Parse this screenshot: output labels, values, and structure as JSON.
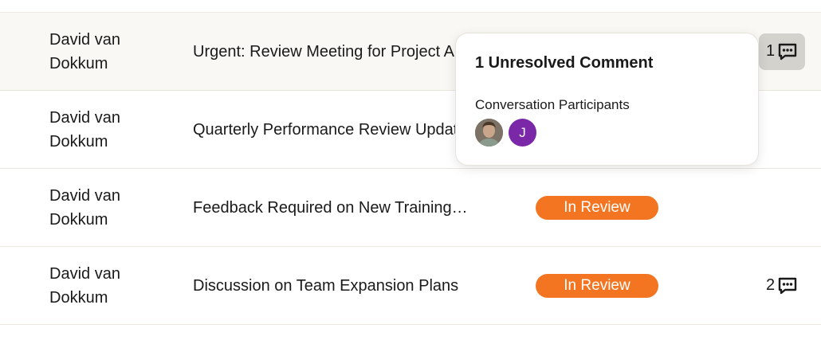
{
  "colors": {
    "status_in_review": "#f47521",
    "avatar_initial_bg": "#7a27a8",
    "row_highlight": "#f9f8f4",
    "comments_btn_active": "#d4d2cd"
  },
  "rows": [
    {
      "author": "David van Dokkum",
      "subject": "Urgent: Review Meeting for Project Alpha",
      "status": "",
      "comments_count": "1",
      "comments_icon": "comment-dots-icon"
    },
    {
      "author": "David van Dokkum",
      "subject": "Quarterly Performance Review Updates",
      "status": "",
      "comments_count": "",
      "comments_icon": ""
    },
    {
      "author": "David van Dokkum",
      "subject": "Feedback Required on New Training…",
      "status": "In Review",
      "comments_count": "",
      "comments_icon": ""
    },
    {
      "author": "David van Dokkum",
      "subject": "Discussion on Team Expansion Plans",
      "status": "In Review",
      "comments_count": "2",
      "comments_icon": "comment-dots-icon"
    }
  ],
  "popover": {
    "title": "1 Unresolved Comment",
    "subtitle": "Conversation Participants",
    "participants": [
      {
        "type": "photo",
        "icon": "person-photo-avatar"
      },
      {
        "type": "initial",
        "initial": "J"
      }
    ]
  }
}
